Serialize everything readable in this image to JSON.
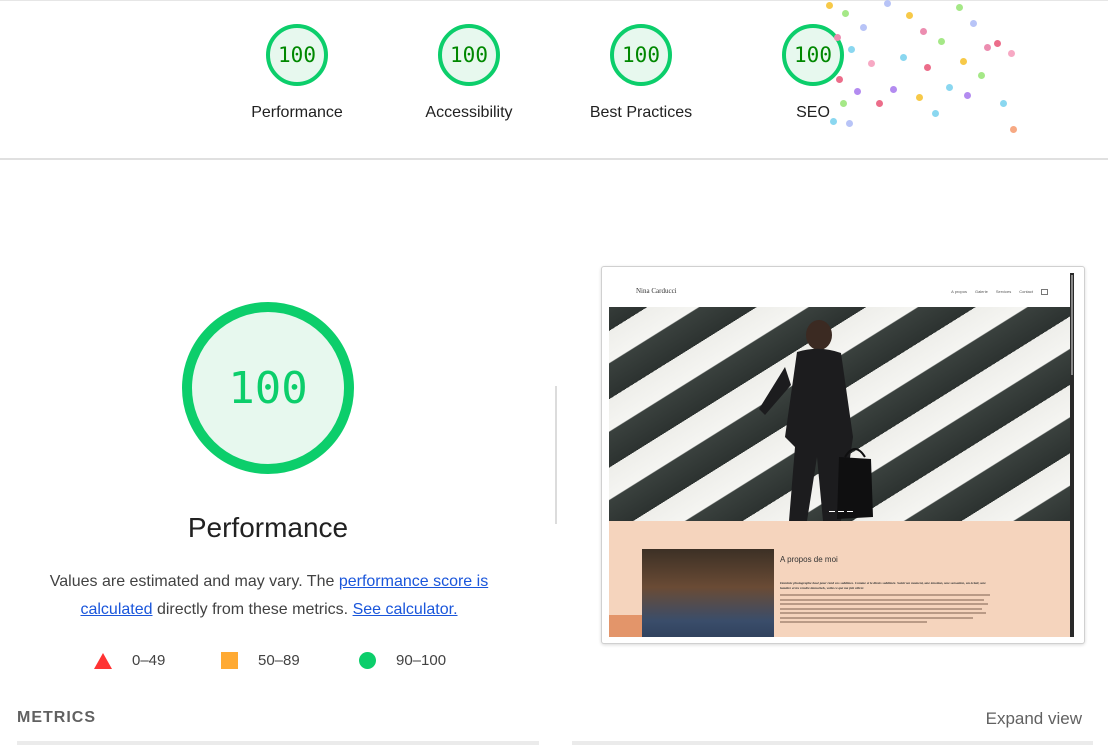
{
  "categories": [
    {
      "score": "100",
      "label": "Performance"
    },
    {
      "score": "100",
      "label": "Accessibility"
    },
    {
      "score": "100",
      "label": "Best Practices"
    },
    {
      "score": "100",
      "label": "SEO"
    }
  ],
  "performance": {
    "score": "100",
    "title": "Performance",
    "desc_prefix": "Values are estimated and may vary. The ",
    "score_link": "performance score is calculated",
    "desc_middle": " directly from these metrics. ",
    "calc_link": "See calculator."
  },
  "legend": {
    "fail": "0–49",
    "average": "50–89",
    "pass": "90–100"
  },
  "screenshot": {
    "site_name": "Nina Carducci",
    "nav": [
      "A propos",
      "Galerie",
      "Services",
      "Contact"
    ],
    "about_title": "A propos de moi",
    "about_lead": "Dominic photographe basé pour rend vos sublimes. Comme si le dirais sublimée. Saisir un moment, une émotion, une sensation, un éclair, une lumière et les rendre immortels, voilà ce qui me fait vibrer."
  },
  "metrics": {
    "heading": "METRICS",
    "expand": "Expand view"
  },
  "colors": {
    "pass": "#0cce6b",
    "average": "#ffaa33",
    "fail": "#ff3333",
    "link": "#1a56db"
  }
}
